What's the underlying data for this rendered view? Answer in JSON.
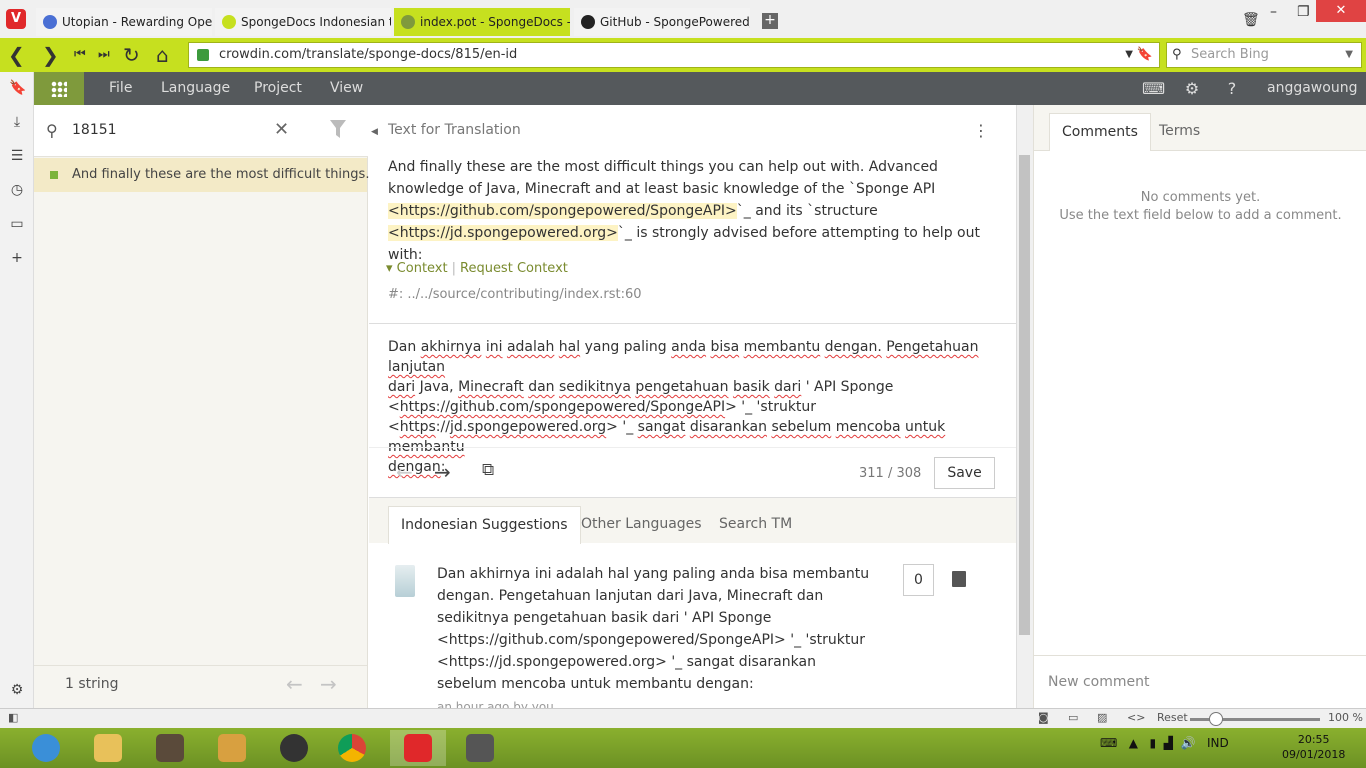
{
  "browser": {
    "tabs": [
      {
        "title": "Utopian - Rewarding Open S",
        "fav": "#4a6fd4"
      },
      {
        "title": "SpongeDocs Indonesian tran",
        "fav": "#c6e01f"
      },
      {
        "title": "index.pot - SpongeDocs - Cr",
        "fav": "#c6e01f"
      },
      {
        "title": "GitHub - SpongePowered/Sp",
        "fav": "#222222"
      }
    ],
    "url": "crowdin.com/translate/sponge-docs/815/en-id",
    "search_placeholder": "Search Bing",
    "accent": "#c6e01f"
  },
  "crowdin": {
    "menu": [
      "File",
      "Language",
      "Project",
      "View"
    ],
    "username": "anggawoung"
  },
  "left": {
    "search_value": "18151",
    "string_item": "And finally these are the most difficult things...",
    "string_count": "1 string"
  },
  "editor": {
    "label": "Text for Translation",
    "source": {
      "p1": "And finally these are the most difficult things you can help out with. Advanced knowledge of Java, Minecraft and at least basic knowledge of the `Sponge API",
      "hl1": "<https://github.com/spongepowered/SpongeAPI>",
      "p2": "`_ and its `structure",
      "hl2": "<https://jd.spongepowered.org>",
      "p3": "`_ is strongly advised before attempting to help out with:"
    },
    "context_label": "Context",
    "request_context": "Request Context",
    "context_path": "#: ../../source/contributing/index.rst:60",
    "translation": {
      "w01": "Dan",
      "w02": "akhirnya",
      "w03": "ini",
      "w04": "adalah",
      "w05": "hal",
      "w06": "yang paling",
      "w07": "anda",
      "w08": "bisa",
      "w09": "membantu",
      "w10": "dengan.",
      "w11": "Pengetahuan",
      "w12": "lanjutan",
      "w13": "dari",
      "w14": "Java,",
      "w15": "Minecraft",
      "w16": "dan",
      "w17": "sedikitnya",
      "w18": "pengetahuan",
      "w19": "basik",
      "w20": "dari",
      "w21": "' API Sponge",
      "w22": "<",
      "w23": "https",
      "w24": "://github.com/",
      "w25": "spongepowered",
      "w26": "/SpongeAPI",
      "w27": "> '_ 'struktur",
      "w28": "<",
      "w29": "https",
      "w30": "://",
      "w31": "jd.spongepowered.org",
      "w32": "> '_",
      "w33": "sangat",
      "w34": "disarankan",
      "w35": "sebelum",
      "w36": "mencoba",
      "w37": "untuk",
      "w38": "membantu",
      "w39": "dengan",
      "w40": ":"
    },
    "counter": "311 / 308",
    "save_label": "Save"
  },
  "suggestions": {
    "tabs": [
      "Indonesian Suggestions",
      "Other Languages",
      "Search TM"
    ],
    "text": "Dan akhirnya ini adalah hal yang paling anda bisa membantu dengan. Pengetahuan lanjutan dari Java, Minecraft dan sedikitnya pengetahuan basik dari ' API Sponge <https://github.com/spongepowered/SpongeAPI> '_ 'struktur <https://jd.spongepowered.org> '_ sangat disarankan sebelum mencoba untuk membantu dengan:",
    "time": "an hour ago by you",
    "votes": "0"
  },
  "right": {
    "tabs": [
      "Comments",
      "Terms"
    ],
    "no_comments": "No comments yet.",
    "hint": "Use the text field below to add a comment.",
    "new_comment_placeholder": "New comment"
  },
  "statusbar": {
    "reset": "Reset",
    "zoom": "100 %",
    "zoom_level": 0.15
  },
  "taskbar": {
    "lang": "IND",
    "time": "20:55",
    "date": "09/01/2018"
  }
}
